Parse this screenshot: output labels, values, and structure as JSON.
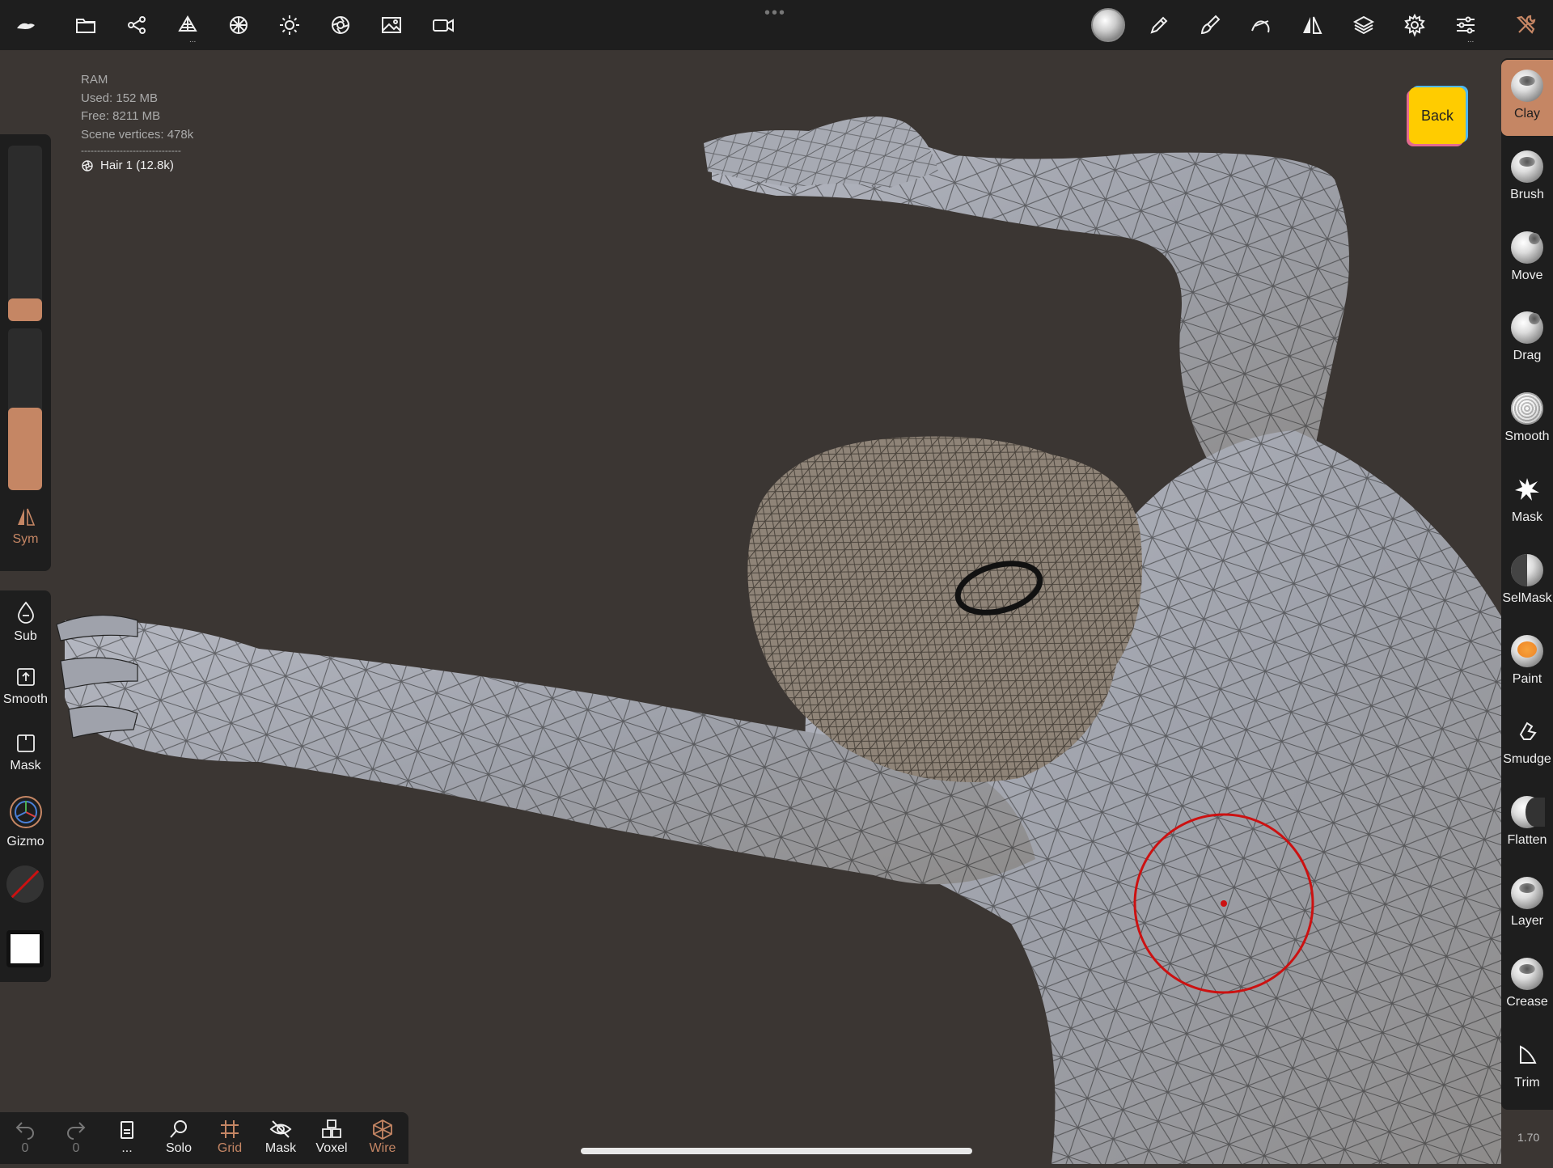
{
  "toolbar": {
    "left_icons": [
      "app-logo-icon",
      "folder-icon",
      "scene-tree-icon",
      "scene-mesh-icon",
      "mesh-topology-icon",
      "light-sun-icon",
      "material-shader-icon",
      "image-background-icon",
      "camera-video-icon"
    ],
    "right_icons": [
      "material-sphere-icon",
      "stroke-pen-icon",
      "brush-tool-icon",
      "stroke-curve-icon",
      "symmetry-icon",
      "layers-icon",
      "settings-gear-icon",
      "sliders-icon",
      "tools-wrench-icon"
    ],
    "more_dots": "•••",
    "sub_dots": "..."
  },
  "stats": {
    "ram_label": "RAM",
    "used": "Used: 152 MB",
    "free": "Free: 8211 MB",
    "vertices": "Scene vertices: 478k",
    "separator": "-------------------------------",
    "selected_object": "Hair 1 (12.8k)"
  },
  "left_panel": {
    "radius_slider_value": 0.08,
    "intensity_slider_value": 0.51,
    "sym_label": "Sym",
    "sub_label": "Sub",
    "smooth_label": "Smooth",
    "mask_label": "Mask",
    "gizmo_label": "Gizmo"
  },
  "right_tools": [
    {
      "label": "Clay",
      "active": true
    },
    {
      "label": "Brush",
      "active": false
    },
    {
      "label": "Move",
      "active": false
    },
    {
      "label": "Drag",
      "active": false
    },
    {
      "label": "Smooth",
      "active": false
    },
    {
      "label": "Mask",
      "active": false
    },
    {
      "label": "SelMask",
      "active": false
    },
    {
      "label": "Paint",
      "active": false
    },
    {
      "label": "Smudge",
      "active": false
    },
    {
      "label": "Flatten",
      "active": false
    },
    {
      "label": "Layer",
      "active": false
    },
    {
      "label": "Crease",
      "active": false
    },
    {
      "label": "Trim",
      "active": false
    }
  ],
  "back_button": "Back",
  "zoom_value": "1.70",
  "bottom_bar": {
    "undo_count": "0",
    "redo_count": "0",
    "more": "...",
    "solo": "Solo",
    "grid": "Grid",
    "mask": "Mask",
    "voxel": "Voxel",
    "wire": "Wire"
  },
  "colors": {
    "accent": "#c58664",
    "background": "#3b3633",
    "panel": "#1e1e1e",
    "back_button": "#ffcc00",
    "brush_cursor": "#cc1111"
  }
}
